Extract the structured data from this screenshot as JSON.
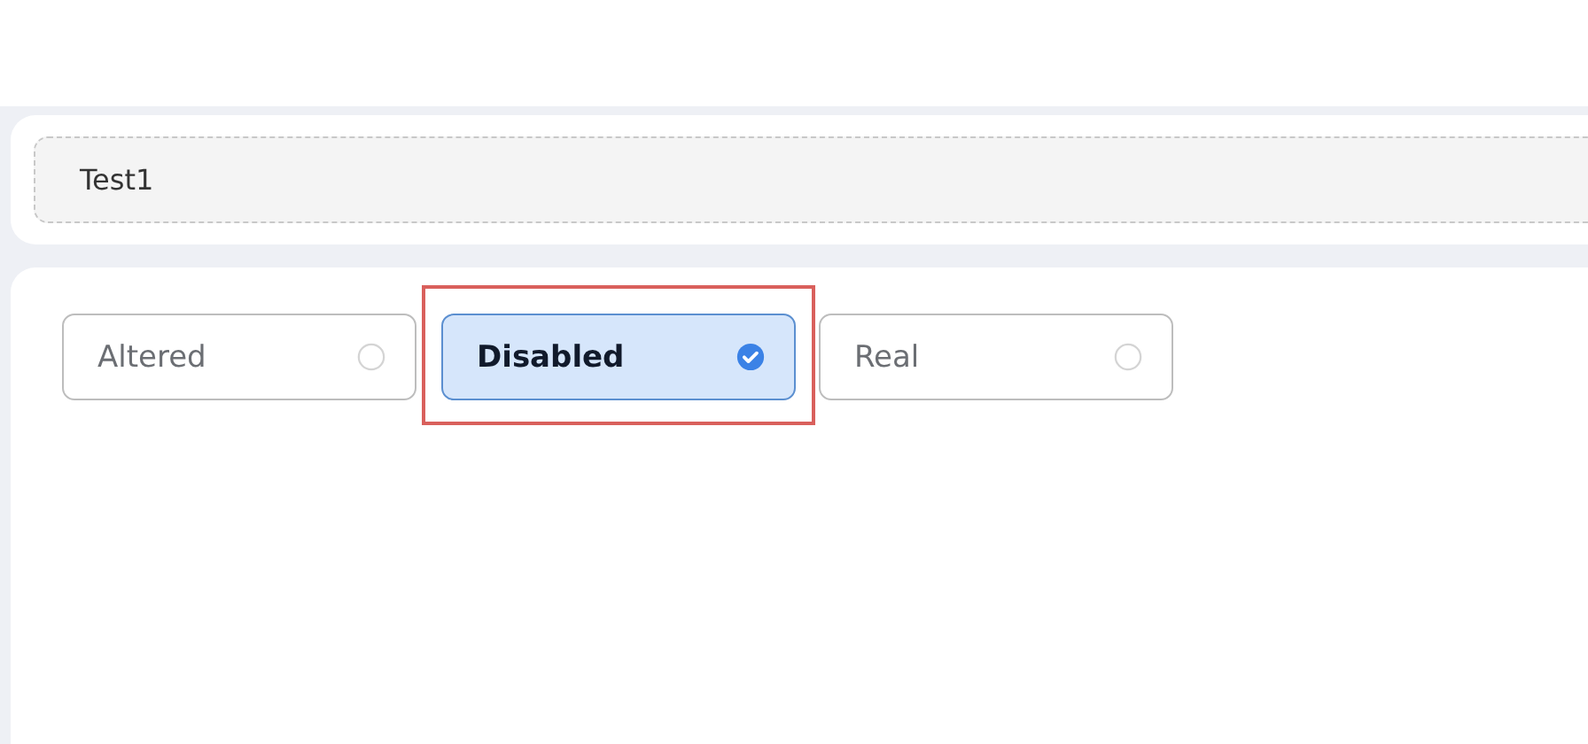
{
  "field": {
    "value": "Test1"
  },
  "options": [
    {
      "label": "Altered",
      "selected": false,
      "highlighted": false
    },
    {
      "label": "Disabled",
      "selected": true,
      "highlighted": true
    },
    {
      "label": "Real",
      "selected": false,
      "highlighted": false
    }
  ]
}
